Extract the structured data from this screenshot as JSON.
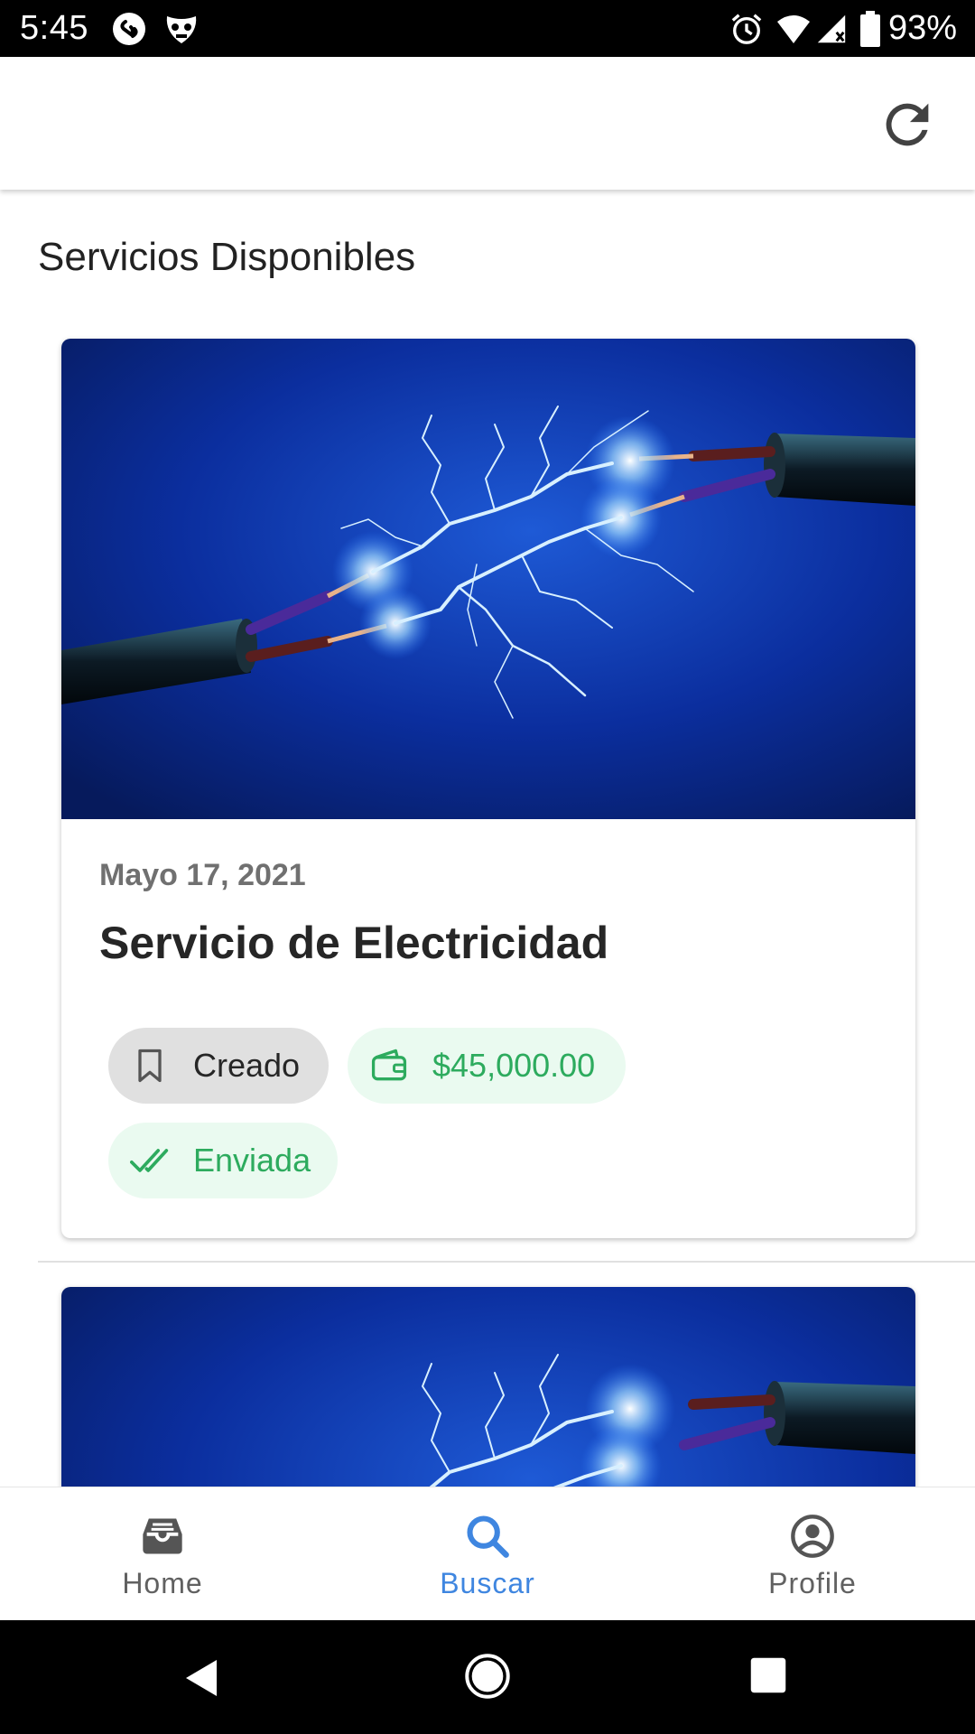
{
  "status_bar": {
    "time": "5:45",
    "battery": "93%",
    "icons": [
      "shazam-icon",
      "mask-icon",
      "alarm-icon",
      "wifi-icon",
      "signal-icon",
      "battery-icon"
    ]
  },
  "app_bar": {
    "refresh_icon": "refresh-icon"
  },
  "main": {
    "section_title": "Servicios Disponibles",
    "cards": [
      {
        "image": "electric-wires-image",
        "date": "Mayo 17, 2021",
        "title": "Servicio de Electricidad",
        "chips": {
          "status_label": "Creado",
          "status_icon": "bookmark-icon",
          "price_label": "$45,000.00",
          "price_icon": "wallet-icon",
          "sent_label": "Enviada",
          "sent_icon": "double-check-icon"
        }
      },
      {
        "image": "electric-wires-image"
      }
    ]
  },
  "bottom_nav": {
    "items": [
      {
        "label": "Home",
        "icon": "inbox-icon",
        "active": false
      },
      {
        "label": "Buscar",
        "icon": "search-icon",
        "active": true
      },
      {
        "label": "Profile",
        "icon": "account-circle-icon",
        "active": false
      }
    ]
  },
  "colors": {
    "accent_blue": "#3f86e0",
    "success_green": "#2dab5e",
    "success_bg": "#eafaf0",
    "chip_gray": "#e0e0e0"
  }
}
